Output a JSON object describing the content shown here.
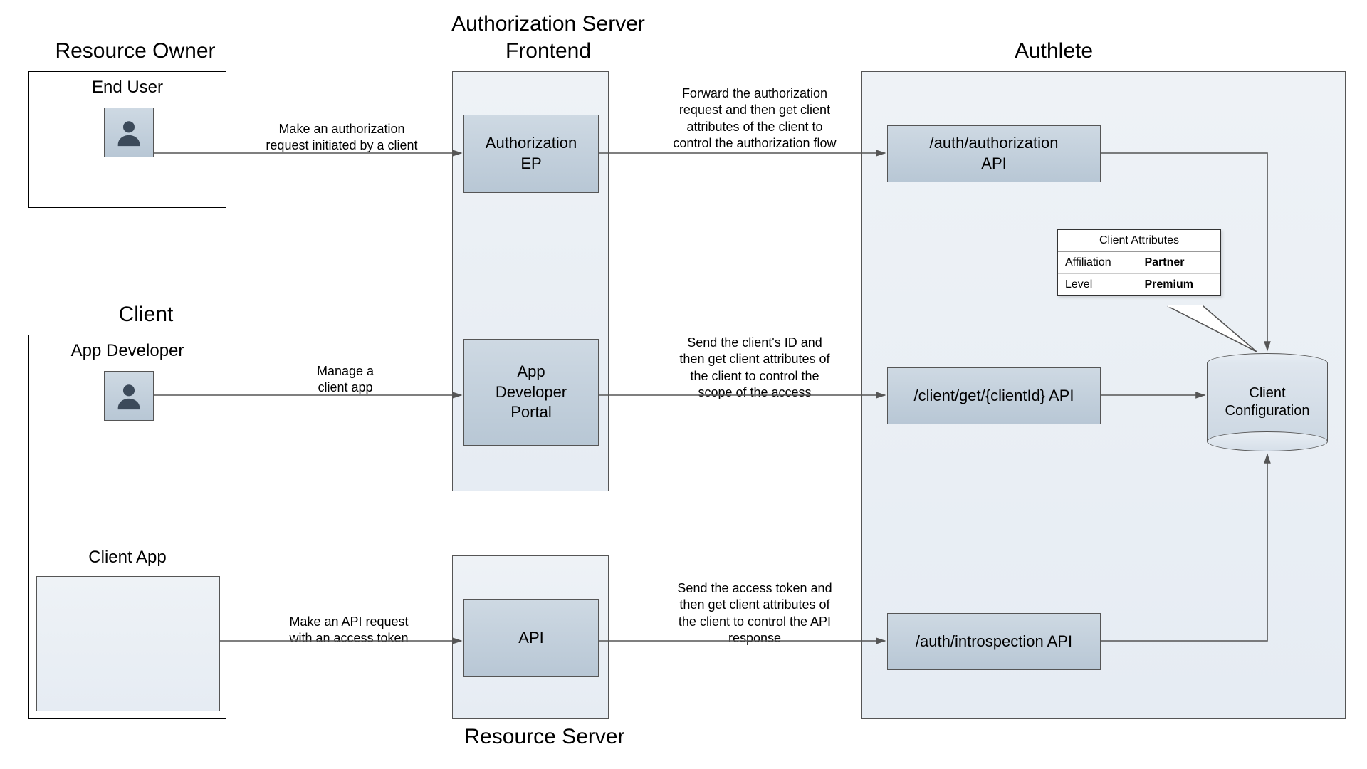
{
  "sections": {
    "resource_owner": "Resource Owner",
    "client": "Client",
    "auth_server_frontend": "Authorization Server\nFrontend",
    "resource_server": "Resource Server",
    "authlete": "Authlete"
  },
  "actors": {
    "end_user": "End User",
    "app_developer": "App Developer",
    "client_app": "Client App"
  },
  "frontend_nodes": {
    "authorization_ep": "Authorization\nEP",
    "app_dev_portal": "App\nDeveloper\nPortal",
    "api": "API"
  },
  "authlete_nodes": {
    "auth_authorization": "/auth/authorization\nAPI",
    "client_get": "/client/get/{clientId} API",
    "auth_introspection": "/auth/introspection API"
  },
  "cylinder": {
    "label": "Client\nConfiguration"
  },
  "callout": {
    "title": "Client Attributes",
    "rows": [
      {
        "key": "Affiliation",
        "value": "Partner"
      },
      {
        "key": "Level",
        "value": "Premium"
      }
    ]
  },
  "arrows": {
    "a1": "Make an authorization\nrequest initiated by a client",
    "a2": "Forward the authorization\nrequest and then get client\nattributes of the client to\ncontrol the authorization flow",
    "a3": "Manage a\nclient app",
    "a4": "Send the client's ID and\nthen get client attributes of\nthe client to control the\nscope of the access",
    "a5": "Make an API request\nwith an access token",
    "a6": "Send the access token and\nthen get client attributes of\nthe client to control the API\nresponse"
  }
}
